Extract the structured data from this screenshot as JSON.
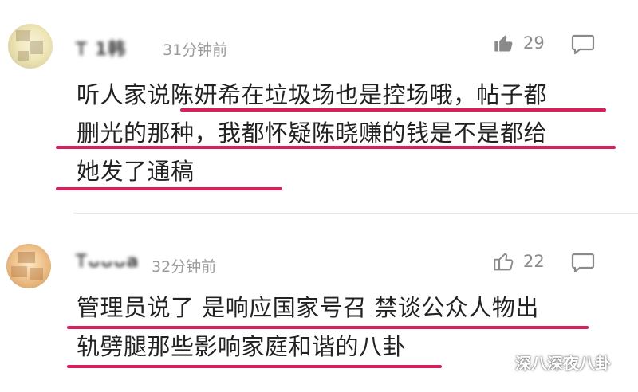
{
  "comments": [
    {
      "username": "Ꭲ 1韩",
      "time": "31分钟前",
      "likes": "29",
      "lines": [
        "听人家说陈妍希在垃圾场也是控场哦，帖子都",
        "删光的那种，我都怀疑陈晓赚的钱是不是都给",
        "她发了通稿"
      ]
    },
    {
      "username": "Ꭲᴗᴗᴗa",
      "time": "32分钟前",
      "likes": "22",
      "lines": [
        "管理员说了 是响应国家号召 禁谈公众人物出",
        "轨劈腿那些影响家庭和谐的八卦"
      ]
    }
  ],
  "watermark": "深八深夜八卦",
  "colors": {
    "underline": "#d6205a",
    "meta": "#9a9a9a"
  },
  "icons": {
    "like": "thumbs-up-icon",
    "reply": "comment-bubble-icon",
    "watermark": "wechat-icon"
  }
}
